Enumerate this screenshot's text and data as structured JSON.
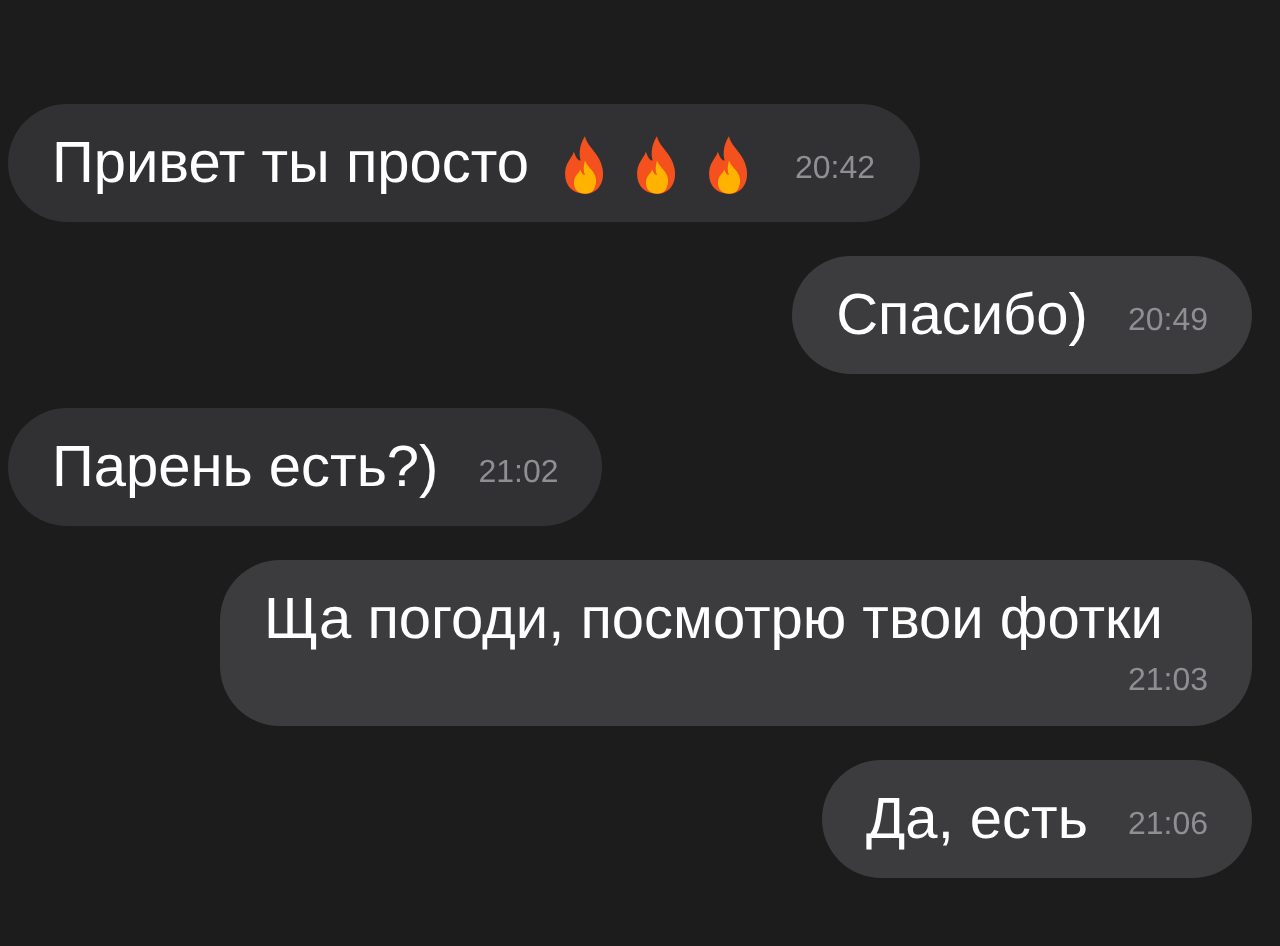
{
  "messages": [
    {
      "outgoing": false,
      "text": "Привет ты просто",
      "emojis": [
        {
          "kind": "fire"
        },
        {
          "kind": "fire"
        },
        {
          "kind": "fire"
        }
      ],
      "time": "20:42"
    },
    {
      "outgoing": true,
      "text": "Спасибо)",
      "time": "20:49"
    },
    {
      "outgoing": false,
      "text": "Парень есть?)",
      "time": "21:02"
    },
    {
      "outgoing": true,
      "text": "Ща погоди, посмотрю твои фотки",
      "time": "21:03"
    },
    {
      "outgoing": true,
      "text": "Да, есть",
      "time": "21:06"
    }
  ]
}
